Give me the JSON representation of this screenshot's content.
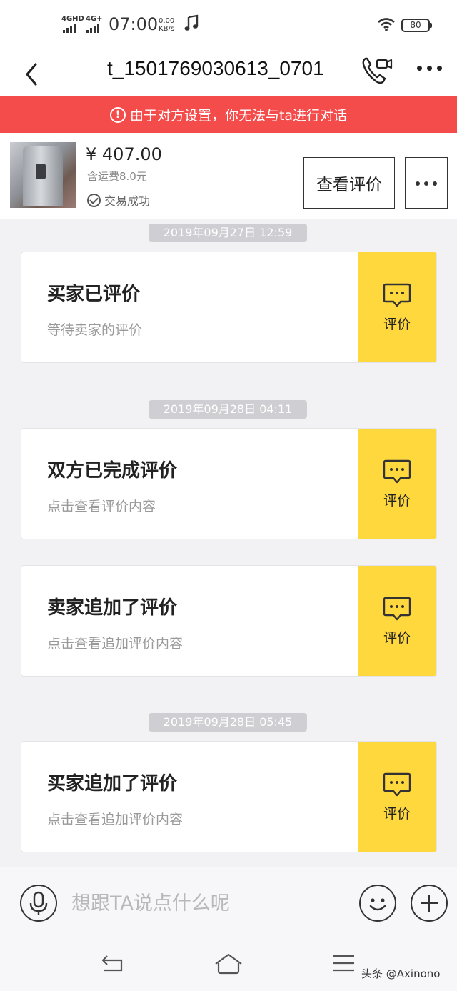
{
  "status_bar": {
    "network_1": "4GHD",
    "network_2": "4G+",
    "time": "07:00",
    "speed_value": "0.00",
    "speed_unit": "KB/s",
    "battery": "80"
  },
  "header": {
    "title": "t_1501769030613_0701"
  },
  "banner": {
    "icon": "!",
    "text": "由于对方设置，你无法与ta进行对话"
  },
  "product": {
    "price": "¥ 407.00",
    "shipping": "含运费8.0元",
    "status": "交易成功",
    "view_review_label": "查看评价"
  },
  "messages": [
    {
      "timestamp": "2019年09月27日 12:59",
      "title": "买家已评价",
      "subtitle": "等待卖家的评价",
      "action_label": "评价"
    },
    {
      "timestamp": "2019年09月28日 04:11",
      "title": "双方已完成评价",
      "subtitle": "点击查看评价内容",
      "action_label": "评价"
    },
    {
      "title": "卖家追加了评价",
      "subtitle": "点击查看追加评价内容",
      "action_label": "评价"
    },
    {
      "timestamp": "2019年09月28日 05:45",
      "title": "买家追加了评价",
      "subtitle": "点击查看追加评价内容",
      "action_label": "评价"
    }
  ],
  "input_bar": {
    "placeholder": "想跟TA说点什么呢"
  },
  "watermark": "头条 @Axinono",
  "colors": {
    "banner": "#f44b4b",
    "card_action": "#ffd83d",
    "background": "#f2f2f5"
  }
}
